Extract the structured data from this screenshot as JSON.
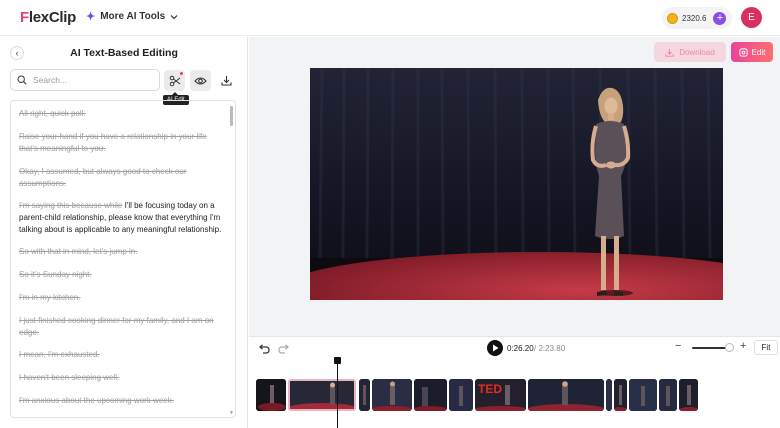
{
  "app": {
    "logo_first": "F",
    "logo_rest": "lexClip",
    "more_tools_label": "More AI Tools",
    "credits": "2320.6",
    "avatar_initial": "E"
  },
  "left_panel": {
    "title": "AI Text-Based Editing",
    "search_placeholder": "Search...",
    "tooltip": "AI Edit",
    "transcript": [
      {
        "cut": "All right, quick poll.",
        "kept": ""
      },
      {
        "cut": "Raise your hand if you have a relationship in your life that's meaningful to you.",
        "kept": ""
      },
      {
        "cut": "Okay, I assumed, but always good to check our assumptions.",
        "kept": ""
      },
      {
        "cut": "I'm saying this because while",
        "kept": " I'll be focusing today on a parent-child relationship, please know that everything I'm talking about is applicable to any meaningful relationship."
      },
      {
        "cut": "So with that in mind, let's jump in.",
        "kept": ""
      },
      {
        "cut": "So it's Sunday night.",
        "kept": ""
      },
      {
        "cut": "I'm in my kitchen.",
        "kept": ""
      },
      {
        "cut": "I just finished cooking dinner for my family, and I am on edge.",
        "kept": ""
      },
      {
        "cut": "I mean, I'm exhausted.",
        "kept": ""
      },
      {
        "cut": "I haven't been sleeping well.",
        "kept": ""
      },
      {
        "cut": "I'm anxious about the upcoming work week.",
        "kept": ""
      }
    ]
  },
  "header_actions": {
    "download_label": "Download",
    "edit_label": "Edit"
  },
  "timeline": {
    "current_time": "0:26.20",
    "total_time": "/ 2:23.80",
    "fit_label": "Fit",
    "zoom_level": 0.9
  }
}
